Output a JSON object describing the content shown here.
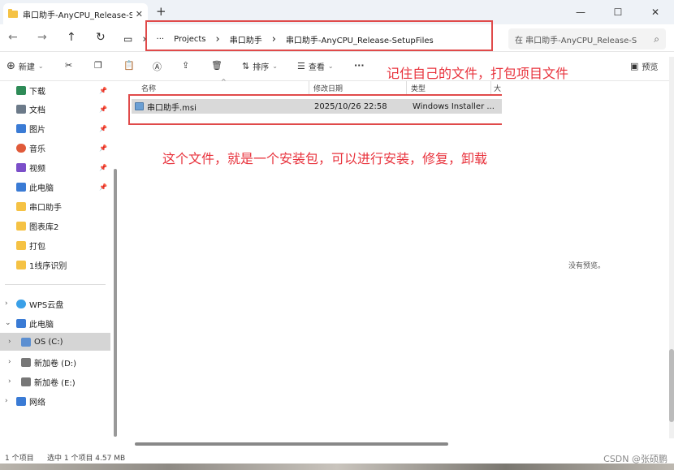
{
  "tab": {
    "title": "串口助手-AnyCPU_Release-Set",
    "close": "✕",
    "new": "+"
  },
  "window": {
    "minimize": "—",
    "maximize": "☐",
    "close": "✕"
  },
  "nav": {
    "back": "←",
    "forward": "→",
    "up": "↑",
    "refresh": "↻",
    "pc": "▭",
    "chev": "›",
    "more": "···"
  },
  "breadcrumb": [
    "Projects",
    "串口助手",
    "串口助手-AnyCPU_Release-SetupFiles"
  ],
  "search": {
    "placeholder": "在 串口助手-AnyCPU_Release-S",
    "icon": "⌕"
  },
  "toolbar": {
    "new_label": "新建",
    "sort_label": "排序",
    "view_label": "查看",
    "more": "···",
    "preview_label": "预览"
  },
  "annotations": {
    "top": "记住自己的文件，打包项目文件",
    "middle": "这个文件，就是一个安装包，可以进行安装，修复，卸载"
  },
  "sidebar": {
    "quick": [
      {
        "label": "下载",
        "color": "#2e8b57"
      },
      {
        "label": "文档",
        "color": "#6c7a89"
      },
      {
        "label": "图片",
        "color": "#3a7bd5"
      },
      {
        "label": "音乐",
        "color": "#e05a3a"
      },
      {
        "label": "视频",
        "color": "#7b4fc9"
      },
      {
        "label": "此电脑",
        "color": "#3a7bd5"
      },
      {
        "label": "串口助手",
        "color": "#f5c244"
      },
      {
        "label": "图表库2",
        "color": "#f5c244"
      },
      {
        "label": "打包",
        "color": "#f5c244"
      },
      {
        "label": "1线序识别",
        "color": "#f5c244"
      }
    ],
    "tree": [
      {
        "label": "WPS云盘",
        "color": "#3aa0e8",
        "chev": "›"
      },
      {
        "label": "此电脑",
        "color": "#3a7bd5",
        "chev": "⌄"
      },
      {
        "label": "OS (C:)",
        "color": "#5c8fd1",
        "chev": "›"
      },
      {
        "label": "新加卷 (D:)",
        "color": "#777",
        "chev": "›"
      },
      {
        "label": "新加卷 (E:)",
        "color": "#777",
        "chev": "›"
      },
      {
        "label": "网络",
        "color": "#3a7bd5",
        "chev": "›"
      }
    ]
  },
  "columns": {
    "name": "名称",
    "date": "修改日期",
    "type": "类型",
    "size": "大"
  },
  "file": {
    "name": "串口助手.msi",
    "date": "2025/10/26 22:58",
    "type": "Windows Installer ..."
  },
  "preview": {
    "empty_text": "没有预览。"
  },
  "status": {
    "count": "1 个项目",
    "selected": "选中 1 个项目  4.57 MB",
    "watermark": "CSDN @张硕鹏"
  }
}
